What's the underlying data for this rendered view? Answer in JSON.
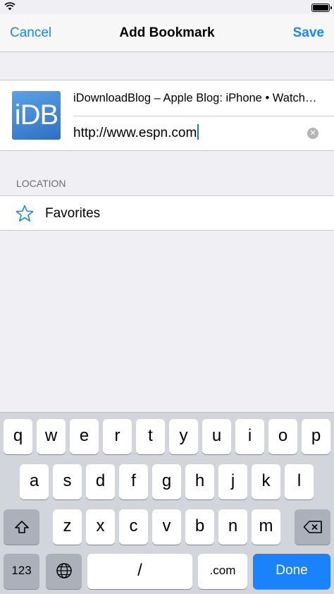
{
  "nav": {
    "cancel": "Cancel",
    "title": "Add Bookmark",
    "save": "Save"
  },
  "bookmark": {
    "thumbnail_text": "iDB",
    "title": "iDownloadBlog – Apple Blog: iPhone • Watch…",
    "url": "http://www.espn.com"
  },
  "location": {
    "header": "LOCATION",
    "folder": "Favorites",
    "icon": "star-icon"
  },
  "keyboard": {
    "row1": [
      "q",
      "w",
      "e",
      "r",
      "t",
      "y",
      "u",
      "i",
      "o",
      "p"
    ],
    "row2": [
      "a",
      "s",
      "d",
      "f",
      "g",
      "h",
      "j",
      "k",
      "l"
    ],
    "row3": [
      "z",
      "x",
      "c",
      "v",
      "b",
      "n",
      "m"
    ],
    "numbers": "123",
    "slash": "/",
    "dotcom": ".com",
    "done": "Done"
  },
  "colors": {
    "accent": "#1a86ff",
    "done_key": "#1a82fb",
    "background": "#efeff4",
    "keyboard_bg": "#d2d5db"
  }
}
